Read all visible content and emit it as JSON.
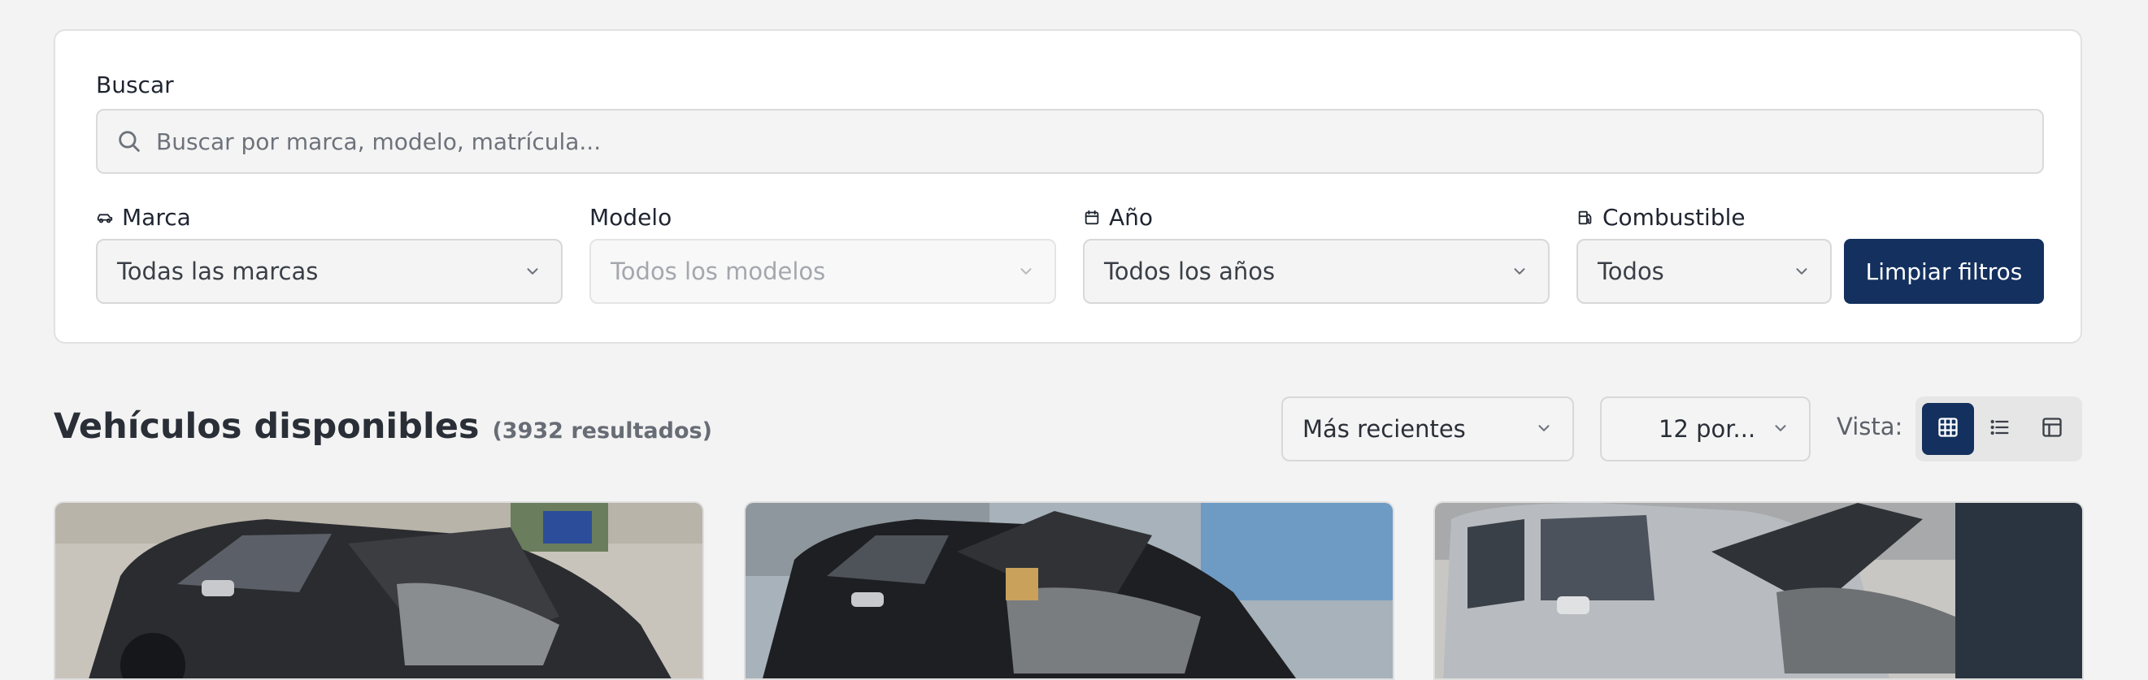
{
  "filters": {
    "search_label": "Buscar",
    "search_placeholder": "Buscar por marca, modelo, matrícula...",
    "brand_label": "Marca",
    "brand_value": "Todas las marcas",
    "model_label": "Modelo",
    "model_value": "Todos los modelos",
    "year_label": "Año",
    "year_value": "Todos los años",
    "fuel_label": "Combustible",
    "fuel_value": "Todos",
    "clear_button": "Limpiar filtros"
  },
  "results": {
    "title": "Vehículos disponibles",
    "count": "(3932 resultados)",
    "sort_value": "Más recientes",
    "per_page_value": "12 por...",
    "view_label": "Vista:",
    "views": [
      "grid-view",
      "list-view",
      "table-view"
    ],
    "active_view": "grid-view"
  },
  "icons": {
    "search": "search-icon",
    "brand": "car-icon",
    "year": "calendar-icon",
    "fuel": "fuel-pump-icon",
    "dropdown": "chevron-down-icon"
  },
  "colors": {
    "primary": "#13305e",
    "background": "#f3f3f3",
    "card": "#ffffff"
  }
}
